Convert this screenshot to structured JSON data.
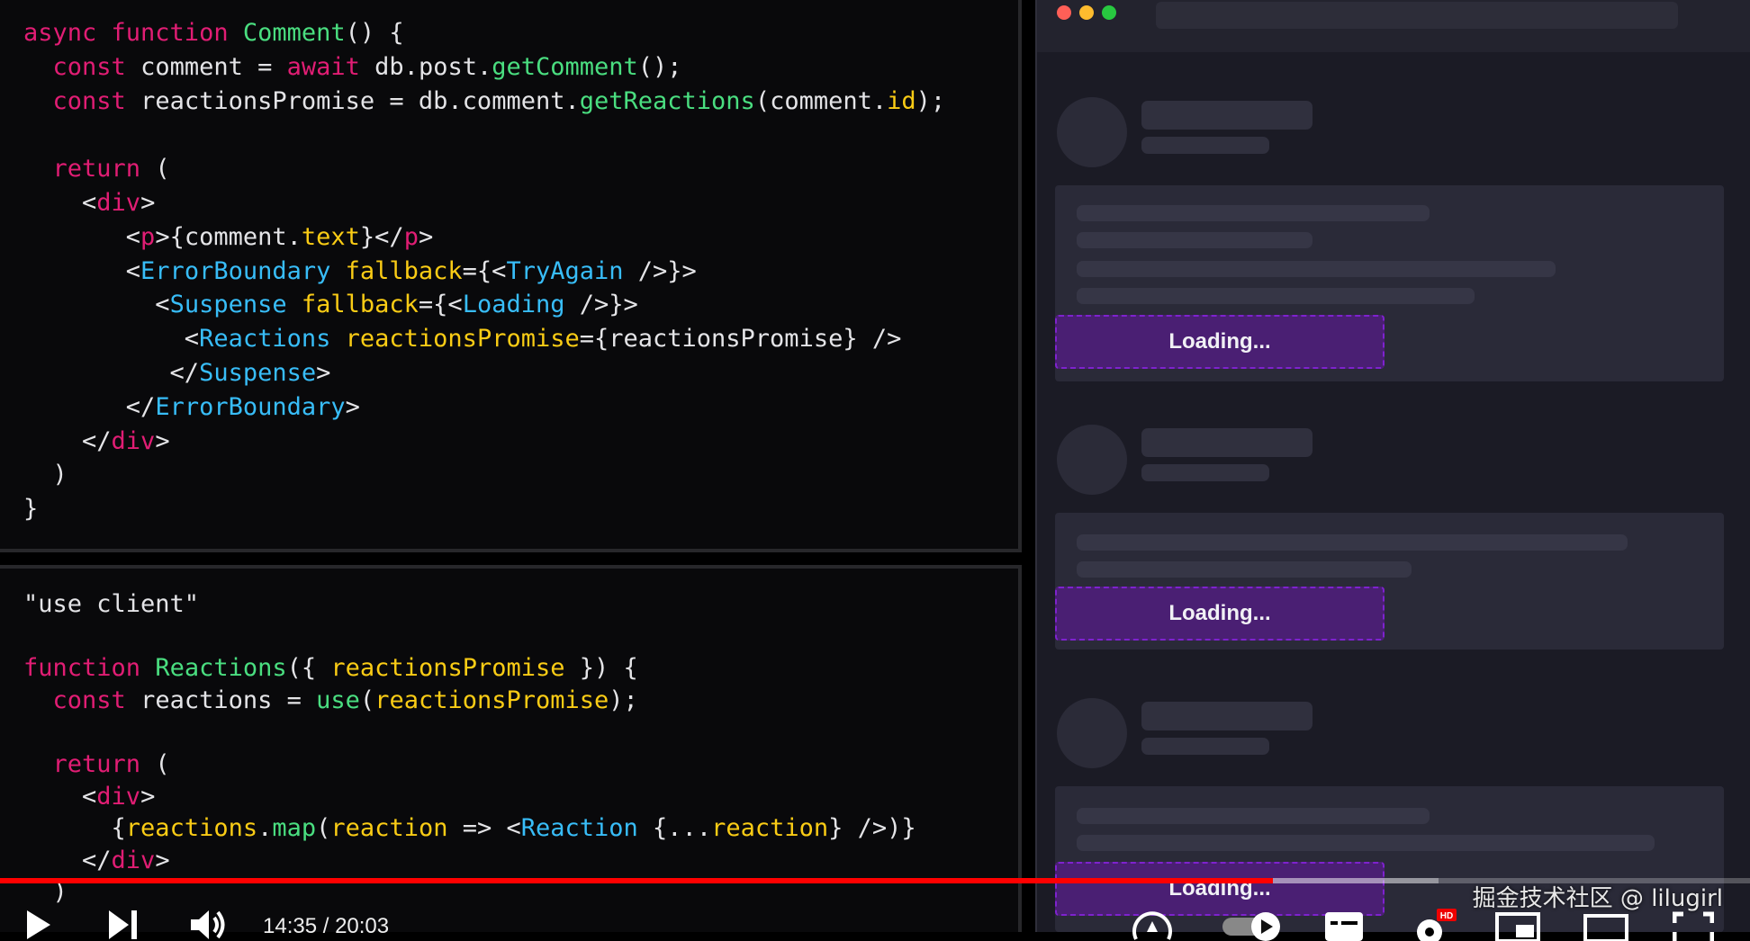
{
  "code_top": {
    "lines": [
      [
        [
          "kw",
          "async function "
        ],
        [
          "fn",
          "Comment"
        ],
        [
          "st",
          "() {"
        ]
      ],
      [
        [
          "st",
          "  "
        ],
        [
          "kw",
          "const "
        ],
        [
          "st",
          "comment = "
        ],
        [
          "kw",
          "await "
        ],
        [
          "st",
          "db.post."
        ],
        [
          "fn",
          "getComment"
        ],
        [
          "st",
          "();"
        ]
      ],
      [
        [
          "st",
          "  "
        ],
        [
          "kw",
          "const "
        ],
        [
          "st",
          "reactionsPromise = db.comment."
        ],
        [
          "fn",
          "getReactions"
        ],
        [
          "st",
          "(comment."
        ],
        [
          "ex",
          "id"
        ],
        [
          "st",
          ");"
        ]
      ],
      [
        [
          "st",
          ""
        ]
      ],
      [
        [
          "st",
          "  "
        ],
        [
          "kw",
          "return "
        ],
        [
          "st",
          "("
        ]
      ],
      [
        [
          "st",
          "    <"
        ],
        [
          "kw",
          "div"
        ],
        [
          "st",
          ">"
        ]
      ],
      [
        [
          "st",
          "       <"
        ],
        [
          "kw",
          "p"
        ],
        [
          "st",
          ">{comment."
        ],
        [
          "ex",
          "text"
        ],
        [
          "st",
          "}</"
        ],
        [
          "kw",
          "p"
        ],
        [
          "st",
          ">"
        ]
      ],
      [
        [
          "st",
          "       <"
        ],
        [
          "tg",
          "ErrorBoundary "
        ],
        [
          "ex",
          "fallback"
        ],
        [
          "st",
          "={<"
        ],
        [
          "tg",
          "TryAgain"
        ],
        [
          "st",
          " />}>"
        ]
      ],
      [
        [
          "st",
          "         <"
        ],
        [
          "tg",
          "Suspense "
        ],
        [
          "ex",
          "fallback"
        ],
        [
          "st",
          "={<"
        ],
        [
          "tg",
          "Loading"
        ],
        [
          "st",
          " />}>"
        ]
      ],
      [
        [
          "st",
          "           <"
        ],
        [
          "tg",
          "Reactions "
        ],
        [
          "ex",
          "reactionsPromise"
        ],
        [
          "st",
          "={reactionsPromise} />"
        ]
      ],
      [
        [
          "st",
          "          </"
        ],
        [
          "tg",
          "Suspense"
        ],
        [
          "st",
          ">"
        ]
      ],
      [
        [
          "st",
          "       </"
        ],
        [
          "tg",
          "ErrorBoundary"
        ],
        [
          "st",
          ">"
        ]
      ],
      [
        [
          "st",
          "    </"
        ],
        [
          "kw",
          "div"
        ],
        [
          "st",
          ">"
        ]
      ],
      [
        [
          "st",
          "  )"
        ]
      ],
      [
        [
          "st",
          "}"
        ]
      ]
    ]
  },
  "code_bottom": {
    "lines": [
      [
        [
          "st",
          "\"use client\""
        ]
      ],
      [
        [
          "st",
          ""
        ]
      ],
      [
        [
          "kw",
          "function "
        ],
        [
          "fn",
          "Reactions"
        ],
        [
          "st",
          "({ "
        ],
        [
          "ex",
          "reactionsPromise"
        ],
        [
          "st",
          " }) {"
        ]
      ],
      [
        [
          "st",
          "  "
        ],
        [
          "kw",
          "const "
        ],
        [
          "st",
          "reactions = "
        ],
        [
          "fn",
          "use"
        ],
        [
          "st",
          "("
        ],
        [
          "ex",
          "reactionsPromise"
        ],
        [
          "st",
          ");"
        ]
      ],
      [
        [
          "st",
          ""
        ]
      ],
      [
        [
          "st",
          "  "
        ],
        [
          "kw",
          "return "
        ],
        [
          "st",
          "("
        ]
      ],
      [
        [
          "st",
          "    <"
        ],
        [
          "kw",
          "div"
        ],
        [
          "st",
          ">"
        ]
      ],
      [
        [
          "st",
          "      {"
        ],
        [
          "ex",
          "reactions"
        ],
        [
          "st",
          "."
        ],
        [
          "fn",
          "map"
        ],
        [
          "st",
          "("
        ],
        [
          "ex",
          "reaction"
        ],
        [
          "st",
          " => <"
        ],
        [
          "tg",
          "Reaction"
        ],
        [
          "st",
          " {..."
        ],
        [
          "ex",
          "reaction"
        ],
        [
          "st",
          "} />)}"
        ]
      ],
      [
        [
          "st",
          "    </"
        ],
        [
          "kw",
          "div"
        ],
        [
          "st",
          ">"
        ]
      ],
      [
        [
          "st",
          "  )"
        ]
      ]
    ]
  },
  "browser": {
    "traffic_lights": {
      "close": "#ff5f57",
      "minimize": "#febc2e",
      "maximize": "#28c840"
    },
    "loading_labels": [
      "Loading...",
      "Loading...",
      "Loading..."
    ]
  },
  "player": {
    "current_time": "14:35",
    "duration": "20:03",
    "time_display": "14:35 / 20:03",
    "progress_fraction": 0.7275,
    "buffered_fraction": 0.822,
    "progress_color": "#ff0000",
    "quality_badge": "HD",
    "watermark": "掘金技术社区 @ lilugirl"
  }
}
